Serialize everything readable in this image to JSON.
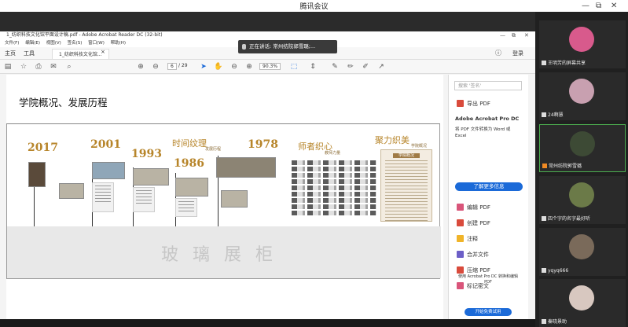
{
  "app": {
    "title": "腾讯会议"
  },
  "window_controls": {
    "minimize": "—",
    "restore": "⧉",
    "close": "✕"
  },
  "acrobat": {
    "title": "1_纺织科技文化馆平面设计稿.pdf - Adobe Acrobat Reader DC (32-bit)",
    "menu": [
      "文件(F)",
      "编辑(E)",
      "视图(V)",
      "签名(S)",
      "窗口(W)",
      "帮助(H)"
    ],
    "tabs": {
      "home": "主页",
      "tools": "工具",
      "doc": "1_纺织科技文化馆..."
    },
    "login": "登录",
    "page_current": "6",
    "page_total": "/ 29",
    "zoom": "90.3%"
  },
  "toast": {
    "text": "正在讲话: 常州纺院郭雪璐;..."
  },
  "document": {
    "heading": "学院概况、发展历程",
    "years": [
      "2017",
      "2001",
      "1993",
      "1986",
      "1978"
    ],
    "titles": {
      "timeline": "时间纹理",
      "teachers": "师者织心",
      "charm": "聚力织美"
    },
    "subtitles": {
      "timeline": "发展历程",
      "teachers": "教师力量",
      "charm": "学院概况"
    },
    "poster_title": "学院概况",
    "glass_cabinet": "玻璃展柜"
  },
  "tools_pane": {
    "search_placeholder": "搜索 '签名'",
    "export_pdf": "导出 PDF",
    "product": "Adobe Acrobat Pro DC",
    "desc": "将 PDF 文件转换为 Word 或 Excel",
    "learn_more": "了解更多信息",
    "items": [
      "编辑 PDF",
      "创建 PDF",
      "注释",
      "合并文件",
      "压缩 PDF",
      "标记密文"
    ],
    "promo": "使用 Acrobat Pro DC 转换和编辑 PDF",
    "free_trial": "开始免费试用"
  },
  "participants": [
    {
      "name": "王明芳的屏幕共享",
      "color": "#d85a8c"
    },
    {
      "name": "24啊慧",
      "color": "#c8a0b0"
    },
    {
      "name": "常州纺院郭雪璐",
      "color": "#3d4a35"
    },
    {
      "name": "四个字的名字最好听",
      "color": "#6b7a48"
    },
    {
      "name": "yqyq666",
      "color": "#7a6a5a"
    },
    {
      "name": "秦晓景助",
      "color": "#d8c8c0"
    }
  ]
}
